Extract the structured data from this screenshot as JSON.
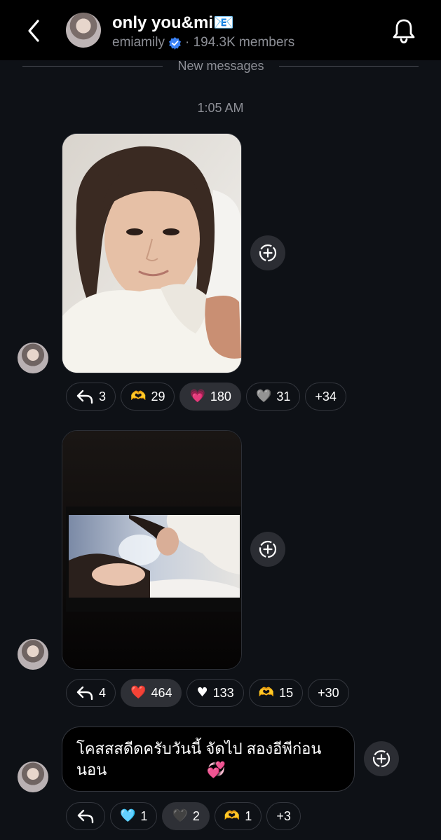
{
  "header": {
    "title": "only you&mi📧",
    "username": "emiamily",
    "members": "· 194.3K members"
  },
  "divider": {
    "label": "New messages"
  },
  "timestamp": "1:05 AM",
  "messages": [
    {
      "type": "photo",
      "description_icon": "selfie-photo",
      "reactions": [
        {
          "icon": "reply-icon",
          "emoji": "",
          "count": "3",
          "active": false
        },
        {
          "icon": "heart-hands-emoji",
          "emoji": "🫶",
          "count": "29",
          "active": false
        },
        {
          "icon": "pink-heart-emoji",
          "emoji": "💗",
          "count": "180",
          "active": true
        },
        {
          "icon": "grey-heart-emoji",
          "emoji": "🩶",
          "count": "31",
          "active": false
        },
        {
          "icon": "",
          "emoji": "",
          "count": "+34",
          "active": false
        }
      ]
    },
    {
      "type": "photo",
      "description_icon": "tv-screen-photo",
      "reactions": [
        {
          "icon": "reply-icon",
          "emoji": "",
          "count": "4",
          "active": false
        },
        {
          "icon": "red-heart-emoji",
          "emoji": "❤️",
          "count": "464",
          "active": true
        },
        {
          "icon": "white-heart-emoji",
          "emoji": "♥",
          "count": "133",
          "active": false
        },
        {
          "icon": "heart-hands-emoji",
          "emoji": "🫶",
          "count": "15",
          "active": false
        },
        {
          "icon": "",
          "emoji": "",
          "count": "+30",
          "active": false
        }
      ]
    },
    {
      "type": "text",
      "line1": "โคสสสดีดครับวันนี้ จัดไป สองอีพีก่อน",
      "line2": "นอน",
      "emoji": "💞",
      "reactions": [
        {
          "icon": "reply-icon",
          "emoji": "",
          "count": "",
          "active": false
        },
        {
          "icon": "blue-heart-emoji",
          "emoji": "🩵",
          "count": "1",
          "active": false
        },
        {
          "icon": "black-heart-emoji",
          "emoji": "🖤",
          "count": "2",
          "active": true
        },
        {
          "icon": "heart-hands-emoji",
          "emoji": "🫶",
          "count": "1",
          "active": false
        },
        {
          "icon": "",
          "emoji": "",
          "count": "+3",
          "active": false
        }
      ]
    }
  ],
  "colors": {
    "background": "#0e1116",
    "header": "#000000",
    "muted_text": "#8d8f96",
    "verified_blue": "#3b82f6",
    "chip_active": "#2e3036"
  }
}
